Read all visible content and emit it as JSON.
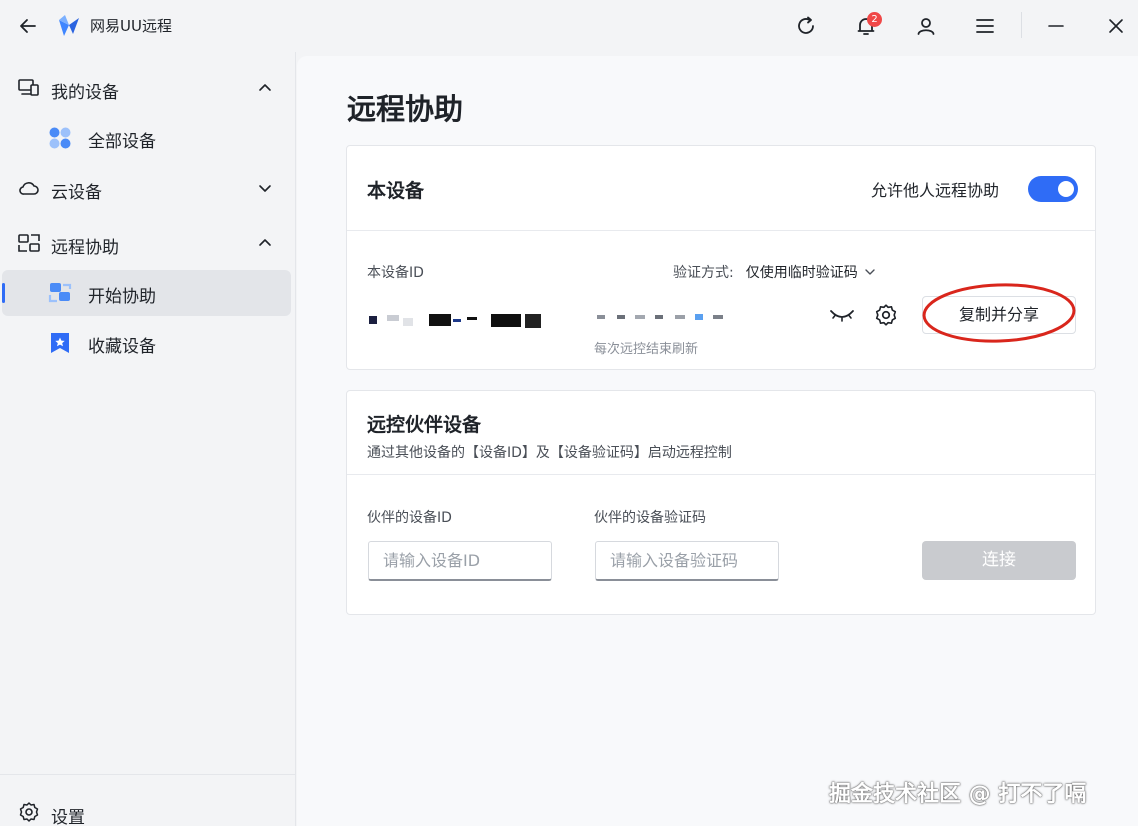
{
  "app": {
    "title": "网易UU远程"
  },
  "titlebar": {
    "notification_count": "2"
  },
  "sidebar": {
    "groups": [
      {
        "label": "我的设备",
        "items": [
          {
            "label": "全部设备"
          }
        ]
      },
      {
        "label": "云设备"
      },
      {
        "label": "远程协助",
        "items": [
          {
            "label": "开始协助"
          },
          {
            "label": "收藏设备"
          }
        ]
      }
    ],
    "settings_label": "设置"
  },
  "main": {
    "page_title": "远程协助",
    "this_device": {
      "title": "本设备",
      "allow_label": "允许他人远程协助",
      "allow_enabled": true,
      "id_label": "本设备ID",
      "verify_label": "验证方式:",
      "verify_value": "仅使用临时验证码",
      "code_hint": "每次远控结束刷新",
      "copy_share_label": "复制并分享"
    },
    "partner": {
      "title": "远控伙伴设备",
      "subtitle": "通过其他设备的【设备ID】及【设备验证码】启动远程控制",
      "id_label": "伙伴的设备ID",
      "code_label": "伙伴的设备验证码",
      "id_placeholder": "请输入设备ID",
      "code_placeholder": "请输入设备验证码",
      "connect_label": "连接"
    }
  },
  "watermark": "掘金技术社区 @ 打不了嗝",
  "colors": {
    "accent": "#2f6cf6",
    "annotation": "#d9261c",
    "disabled": "#c9cbcf"
  }
}
